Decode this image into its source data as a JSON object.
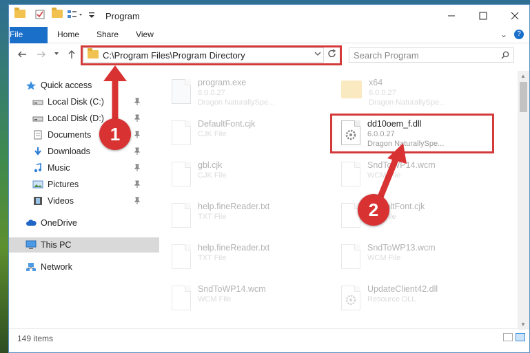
{
  "window": {
    "title": "Program"
  },
  "ribbon": {
    "tabs": [
      "File",
      "Home",
      "Share",
      "View"
    ]
  },
  "nav": {
    "address": "C:\\Program Files\\Program Directory",
    "search_placeholder": "Search Program"
  },
  "sidebar": {
    "items": [
      {
        "label": "Quick access",
        "icon": "star-icon",
        "pinned": false
      },
      {
        "label": "Local Disk (C:)",
        "icon": "drive-icon",
        "pinned": true
      },
      {
        "label": "Local Disk (D:)",
        "icon": "drive-icon",
        "pinned": true
      },
      {
        "label": "Documents",
        "icon": "documents-icon",
        "pinned": true
      },
      {
        "label": "Downloads",
        "icon": "download-icon",
        "pinned": true
      },
      {
        "label": "Music",
        "icon": "music-icon",
        "pinned": true
      },
      {
        "label": "Pictures",
        "icon": "pictures-icon",
        "pinned": true
      },
      {
        "label": "Videos",
        "icon": "videos-icon",
        "pinned": true
      },
      {
        "label": "OneDrive",
        "icon": "cloud-icon",
        "pinned": false
      },
      {
        "label": "This PC",
        "icon": "computer-icon",
        "pinned": false,
        "selected": true
      },
      {
        "label": "Network",
        "icon": "network-icon",
        "pinned": false
      }
    ]
  },
  "files": [
    {
      "name": "program.exe",
      "sub1": "6.0.0.27",
      "sub2": "Dragon NaturallySpe..."
    },
    {
      "name": "x64",
      "sub1": "6.0.0.27",
      "sub2": "Dragon NaturallySpe..."
    },
    {
      "name": "DefaultFont.cjk",
      "sub1": "CJK File",
      "sub2": ""
    },
    {
      "name": "dd10oem_f.dll",
      "sub1": "6.0.0.27",
      "sub2": "Dragon NaturallySpe..."
    },
    {
      "name": "gbl.cjk",
      "sub1": "CJK File",
      "sub2": ""
    },
    {
      "name": "SndToWP14.wcm",
      "sub1": "WCM File",
      "sub2": ""
    },
    {
      "name": "help.fineReader.txt",
      "sub1": "TXT File",
      "sub2": ""
    },
    {
      "name": "DefaultFont.cjk",
      "sub1": "CJK File",
      "sub2": ""
    },
    {
      "name": "help.fineReader.txt",
      "sub1": "TXT File",
      "sub2": ""
    },
    {
      "name": "SndToWP13.wcm",
      "sub1": "WCM File",
      "sub2": ""
    },
    {
      "name": "SndToWP14.wcm",
      "sub1": "WCM File",
      "sub2": ""
    },
    {
      "name": "UpdateClient42.dll",
      "sub1": "Resource DLL",
      "sub2": ""
    }
  ],
  "status": {
    "count": "149 items"
  },
  "annotations": {
    "badge1": "1",
    "badge2": "2"
  },
  "colors": {
    "accent": "#1a6fc9",
    "highlight": "#d33a3a"
  }
}
